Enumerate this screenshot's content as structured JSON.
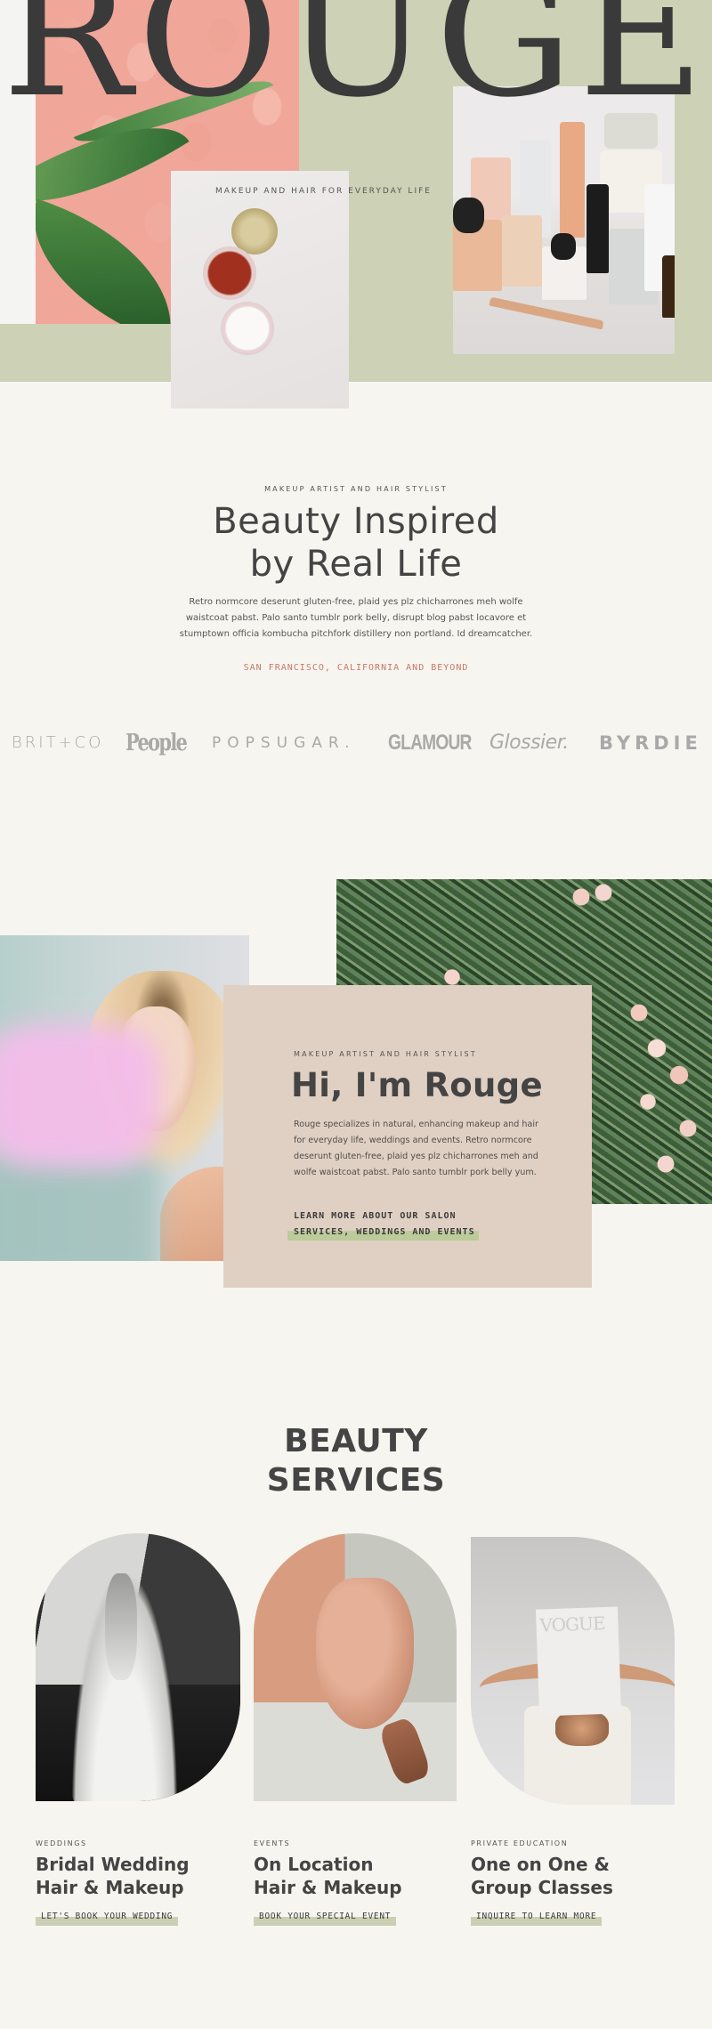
{
  "hero": {
    "brand": "ROUGE",
    "tagline": "MAKEUP AND HAIR FOR EVERYDAY LIFE",
    "images": [
      "flamingo-wallpaper-with-palm-leaves",
      "lip-balm-jars",
      "cosmetics-products-collection"
    ],
    "band_color": "#cdd1b5"
  },
  "intro": {
    "eyebrow": "MAKEUP ARTIST AND HAIR STYLIST",
    "title_line1": "Beauty Inspired",
    "title_line2": "by Real Life",
    "body": "Retro normcore deserunt gluten-free, plaid yes plz chicharrones meh wolfe waistcoat pabst. Palo santo tumblr pork belly, disrupt blog pabst locavore et stumptown officia kombucha pitchfork distillery non portland. Id dreamcatcher.",
    "location": "SAN FRANCISCO, CALIFORNIA AND BEYOND",
    "location_color": "#c7786a"
  },
  "press": {
    "logos": [
      "BRIT+CO",
      "People",
      "POPSUGAR.",
      "GLAMOUR",
      "Glossier.",
      "BYRDIE"
    ]
  },
  "about": {
    "eyebrow": "MAKEUP ARTIST AND HAIR STYLIST",
    "title": "Hi, I'm Rouge",
    "body": "Rouge specializes in natural, enhancing makeup and hair for everyday life, weddings and events. Retro normcore deserunt gluten-free, plaid yes plz chicharrones meh and wolfe waistcoat pabst. Palo santo tumblr pork belly yum.",
    "link_label": "LEARN MORE ABOUT OUR SALON SERVICES, WEDDINGS AND EVENTS",
    "card_color": "#e0d0c3",
    "highlight_color": "#bccb9a"
  },
  "services": {
    "title_line1": "BEAUTY",
    "title_line2": "SERVICES",
    "items": [
      {
        "category": "WEDDINGS",
        "title_line1": "Bridal Wedding",
        "title_line2": "Hair & Makeup",
        "cta": "LET'S BOOK YOUR WEDDING",
        "image": "bride-in-white-gown"
      },
      {
        "category": "EVENTS",
        "title_line1": "On Location",
        "title_line2": "Hair & Makeup",
        "cta": "BOOK YOUR SPECIAL EVENT",
        "image": "peach-sleeve-on-wall"
      },
      {
        "category": "PRIVATE EDUCATION",
        "title_line1": "One on One &",
        "title_line2": "Group Classes",
        "cta": "INQUIRE TO LEARN MORE",
        "image": "woman-holding-magazine",
        "magazine_text": "VOGUE"
      }
    ],
    "cta_highlight_color": "#cbd0b4"
  }
}
